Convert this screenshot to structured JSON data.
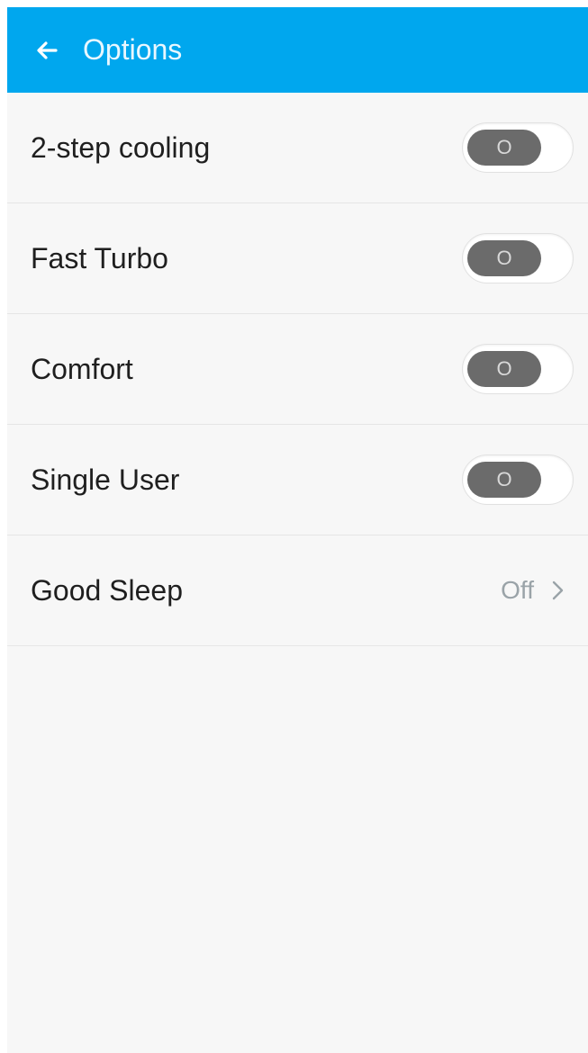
{
  "header": {
    "title": "Options",
    "back_icon": "arrow-left-icon",
    "background": "#00a7ee"
  },
  "options": [
    {
      "label": "2-step cooling",
      "type": "toggle",
      "state": "off",
      "knob_text": "O"
    },
    {
      "label": "Fast Turbo",
      "type": "toggle",
      "state": "off",
      "knob_text": "O"
    },
    {
      "label": "Comfort",
      "type": "toggle",
      "state": "off",
      "knob_text": "O"
    },
    {
      "label": "Single User",
      "type": "toggle",
      "state": "off",
      "knob_text": "O"
    },
    {
      "label": "Good Sleep",
      "type": "link",
      "value": "Off",
      "icon": "chevron-right-icon"
    }
  ],
  "colors": {
    "accent": "#00a7ee",
    "toggle_knob": "#6b6b6b",
    "value_text": "#9aa3a8"
  }
}
